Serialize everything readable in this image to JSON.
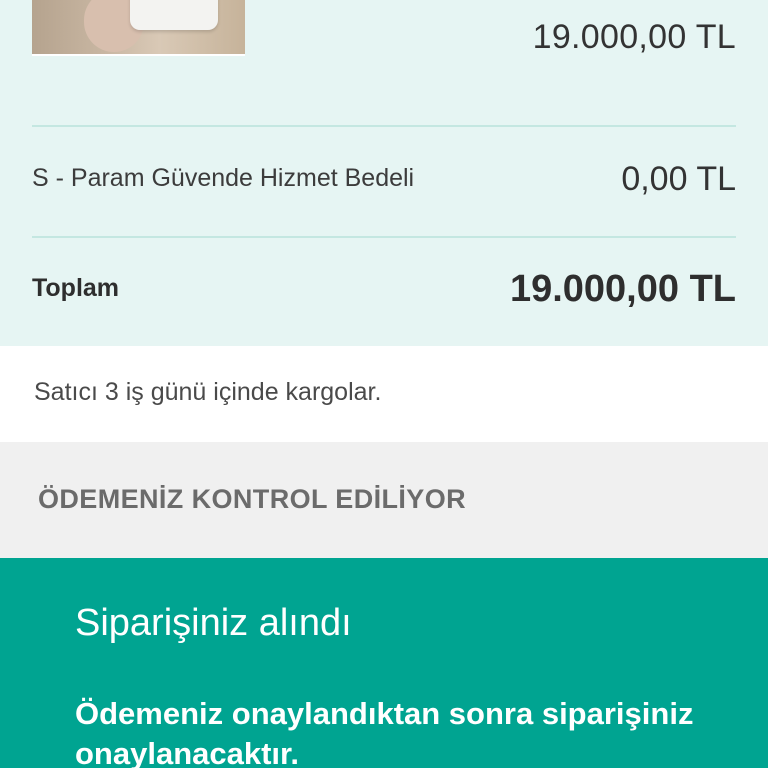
{
  "summary": {
    "product": {
      "image_alt": "product-photo",
      "price": "19.000,00 TL"
    },
    "service_fee": {
      "label": "S - Param Güvende Hizmet Bedeli",
      "value": "0,00 TL"
    },
    "total": {
      "label": "Toplam",
      "value": "19.000,00 TL"
    }
  },
  "shipping": {
    "text": "Satıcı 3 iş günü içinde kargolar."
  },
  "payment_check": {
    "text": "ÖDEMENİZ KONTROL EDİLİYOR"
  },
  "order_banner": {
    "title": "Siparişiniz alındı",
    "message": "Ödemeniz onaylandıktan sonra siparişiniz onaylanacaktır."
  },
  "colors": {
    "summary_bg": "#e6f5f3",
    "divider": "#c4e7e1",
    "banner_bg": "#00a491",
    "payment_check_bg": "#f0f0f0"
  }
}
